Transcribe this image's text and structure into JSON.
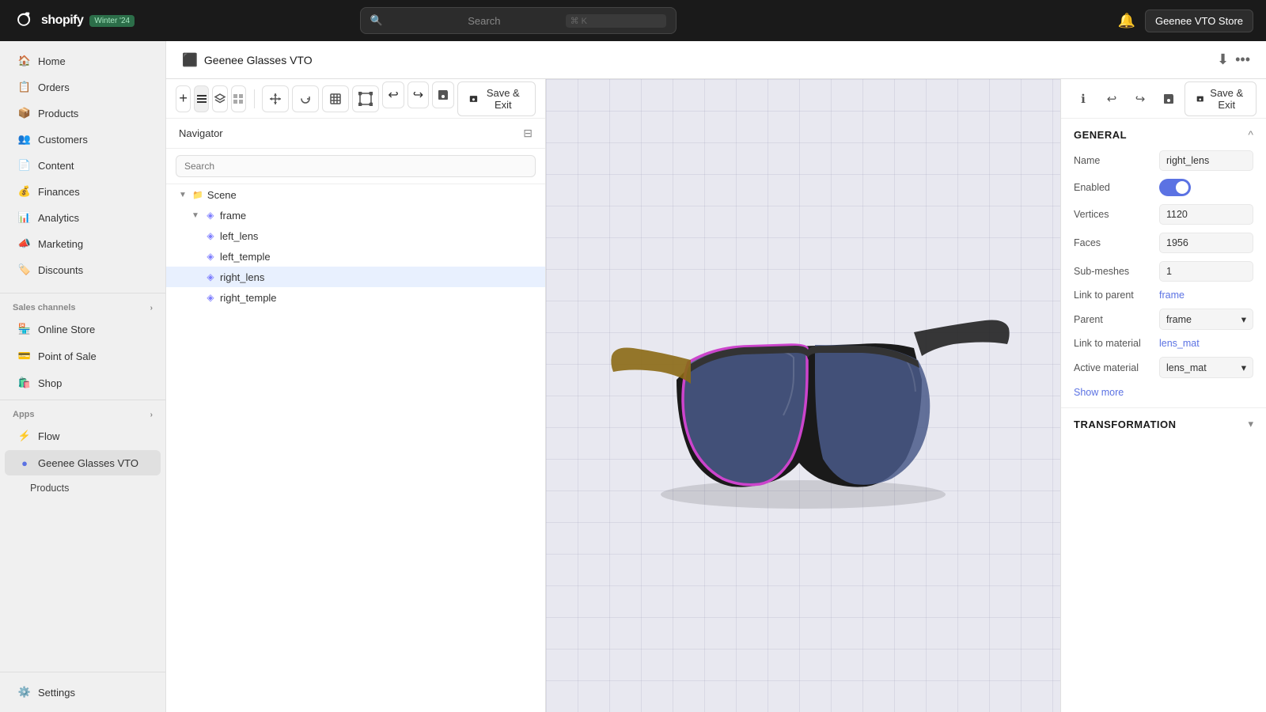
{
  "topbar": {
    "logo_text": "shopify",
    "badge": "Winter '24",
    "search_placeholder": "Search",
    "search_shortcut": "⌘ K",
    "store_name": "Geenee VTO Store"
  },
  "sidebar": {
    "nav_items": [
      {
        "id": "home",
        "label": "Home",
        "icon": "🏠"
      },
      {
        "id": "orders",
        "label": "Orders",
        "icon": "📋"
      },
      {
        "id": "products",
        "label": "Products",
        "icon": "📦"
      },
      {
        "id": "customers",
        "label": "Customers",
        "icon": "👥"
      },
      {
        "id": "content",
        "label": "Content",
        "icon": "📄"
      },
      {
        "id": "finances",
        "label": "Finances",
        "icon": "💰"
      },
      {
        "id": "analytics",
        "label": "Analytics",
        "icon": "📊"
      },
      {
        "id": "marketing",
        "label": "Marketing",
        "icon": "📣"
      },
      {
        "id": "discounts",
        "label": "Discounts",
        "icon": "🏷️"
      }
    ],
    "sales_channels_label": "Sales channels",
    "sales_channels": [
      {
        "id": "online-store",
        "label": "Online Store",
        "icon": "🏪"
      },
      {
        "id": "point-of-sale",
        "label": "Point of Sale",
        "icon": "💳"
      },
      {
        "id": "shop",
        "label": "Shop",
        "icon": "🛍️"
      }
    ],
    "apps_label": "Apps",
    "apps": [
      {
        "id": "flow",
        "label": "Flow",
        "icon": "⚡"
      },
      {
        "id": "geenee-glasses",
        "label": "Geenee Glasses VTO",
        "icon": "👓",
        "active": true
      },
      {
        "id": "products-sub",
        "label": "Products",
        "icon": "",
        "sub": true
      }
    ],
    "settings": "Settings"
  },
  "page_header": {
    "icon": "⬛",
    "title": "Geenee Glasses VTO",
    "download_tooltip": "Download",
    "more_tooltip": "More"
  },
  "toolbar": {
    "add_label": "+",
    "list_icon": "≡",
    "layers_icon": "⧉",
    "texture_icon": "⊞",
    "move_icon": "✥",
    "refresh_icon": "↻",
    "frame_icon": "⊡",
    "crop_icon": "⬚",
    "undo_icon": "↩",
    "redo_icon": "↪",
    "save_icon": "💾",
    "save_exit_label": "Save & Exit",
    "filter_icon": "⊟"
  },
  "navigator": {
    "title": "Navigator",
    "search_placeholder": "Search",
    "tree": [
      {
        "id": "scene",
        "label": "Scene",
        "indent": 0,
        "type": "folder",
        "collapsed": false
      },
      {
        "id": "frame",
        "label": "frame",
        "indent": 1,
        "type": "mesh",
        "collapsed": false
      },
      {
        "id": "left_lens",
        "label": "left_lens",
        "indent": 2,
        "type": "mesh"
      },
      {
        "id": "left_temple",
        "label": "left_temple",
        "indent": 2,
        "type": "mesh"
      },
      {
        "id": "right_lens",
        "label": "right_lens",
        "indent": 2,
        "type": "mesh",
        "selected": true
      },
      {
        "id": "right_temple",
        "label": "right_temple",
        "indent": 2,
        "type": "mesh"
      }
    ]
  },
  "parameters": {
    "section_title": "GENERAL",
    "name_label": "Name",
    "name_value": "right_lens",
    "enabled_label": "Enabled",
    "vertices_label": "Vertices",
    "vertices_value": "1120",
    "faces_label": "Faces",
    "faces_value": "1956",
    "submeshes_label": "Sub-meshes",
    "submeshes_value": "1",
    "link_parent_label": "Link to parent",
    "link_parent_value": "frame",
    "parent_label": "Parent",
    "parent_value": "frame",
    "link_material_label": "Link to material",
    "link_material_value": "lens_mat",
    "active_material_label": "Active material",
    "active_material_value": "lens_mat",
    "show_more": "Show more",
    "transformation_title": "TRANSFORMATION"
  }
}
